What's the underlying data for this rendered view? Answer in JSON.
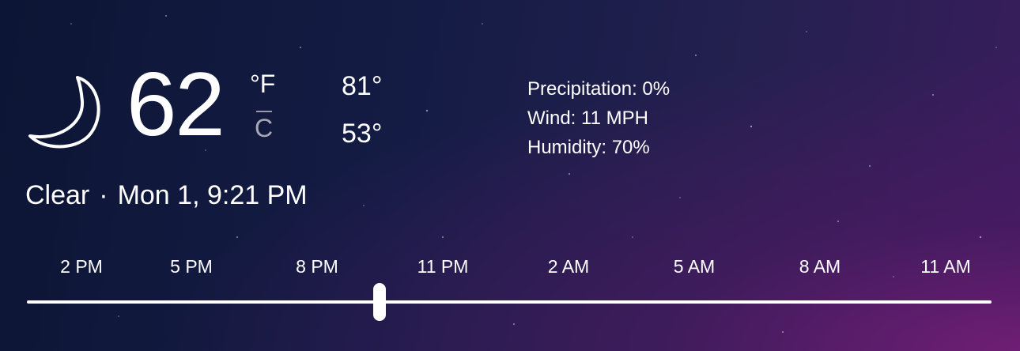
{
  "current": {
    "condition_icon": "moon-icon",
    "temperature": "62",
    "unit_f": "°F",
    "unit_c": "C",
    "high": "81°",
    "low": "53°",
    "condition": "Clear",
    "separator": "·",
    "datetime": "Mon 1, 9:21 PM"
  },
  "details": {
    "precipitation": "Precipitation: 0%",
    "wind": "Wind: 11 MPH",
    "humidity": "Humidity: 70%"
  },
  "timeline": {
    "hours": [
      "2 PM",
      "5 PM",
      "8 PM",
      "11 PM",
      "2 AM",
      "5 AM",
      "8 AM",
      "11 AM"
    ],
    "slider_position": 0.36
  },
  "colors": {
    "background_dark": "#0d1535",
    "background_accent": "#5a1f7a",
    "text": "#ffffff",
    "inactive_unit": "#a8a8b4"
  }
}
